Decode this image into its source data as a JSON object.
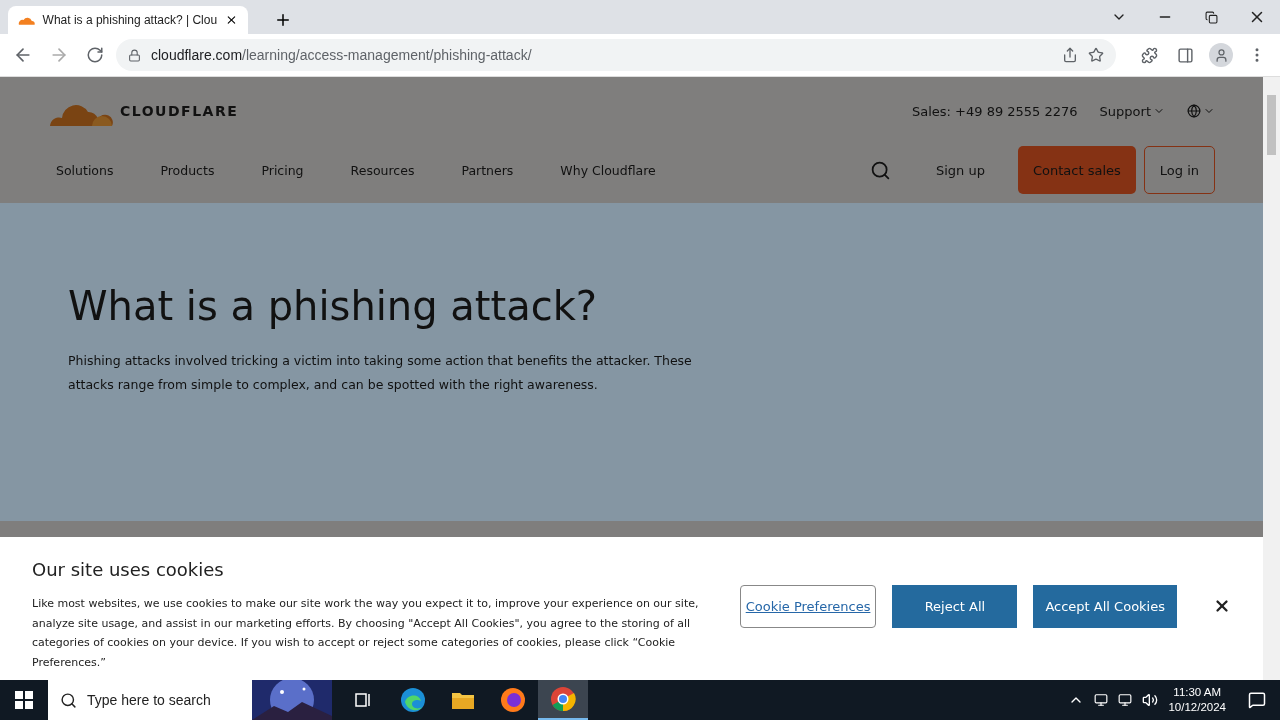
{
  "browser": {
    "tab_title": "What is a phishing attack? | Clou",
    "url_host": "cloudflare.com",
    "url_path": "/learning/access-management/phishing-attack/"
  },
  "header": {
    "logo": "CLOUDFLARE",
    "sales": "Sales: +49 89 2555 2276",
    "support": "Support",
    "nav": [
      "Solutions",
      "Products",
      "Pricing",
      "Resources",
      "Partners",
      "Why Cloudflare"
    ],
    "sign_up": "Sign up",
    "contact_sales": "Contact sales",
    "log_in": "Log in"
  },
  "hero": {
    "title": "What is a phishing attack?",
    "lead": "Phishing attacks involved tricking a victim into taking some action that benefits the attacker. These attacks range from simple to complex, and can be spotted with the right awareness."
  },
  "cookie_banner": {
    "title": "Our site uses cookies",
    "text": "Like most websites, we use cookies to make our site work the way you expect it to, improve your experience on our site, analyze site usage, and assist in our marketing efforts. By choosing \"Accept All Cookies\", you agree to the storing of all categories of cookies on your device. If you wish to accept or reject some categories of cookies, please click “Cookie Preferences.”",
    "buttons": [
      {
        "label": "Cookie Preferences",
        "kind": "link"
      },
      {
        "label": "Reject All",
        "kind": "solid"
      },
      {
        "label": "Accept All Cookies",
        "kind": "solid"
      }
    ]
  },
  "taskbar": {
    "search_placeholder": "Type here to search",
    "time": "11:30 AM",
    "date": "10/12/2024",
    "apps": [
      {
        "kind": "taskview",
        "selected": false
      },
      {
        "kind": "edge",
        "selected": false
      },
      {
        "kind": "files",
        "selected": false
      },
      {
        "kind": "firefox",
        "selected": false
      },
      {
        "kind": "chrome",
        "selected": true
      }
    ]
  }
}
